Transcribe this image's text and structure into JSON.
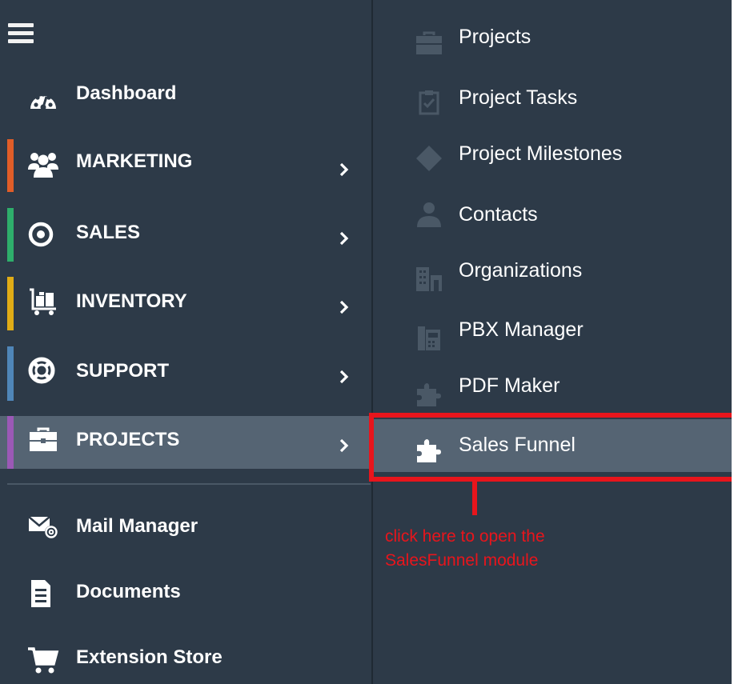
{
  "colors": {
    "sidebar_bg": "#2d3a48",
    "active_bg": "#556473",
    "highlight": "#e8151c",
    "marketing_accent": "#e05d28",
    "sales_accent": "#2eae6b",
    "inventory_accent": "#e0ac16",
    "support_accent": "#4f86b8",
    "projects_accent": "#9b59b6"
  },
  "sidebar": {
    "menu_icon": "hamburger-icon",
    "items": [
      {
        "label": "Dashboard",
        "icon": "dashboard-gauge-icon"
      },
      {
        "label": "MARKETING",
        "icon": "users-group-icon",
        "has_submenu": true
      },
      {
        "label": "SALES",
        "icon": "target-icon",
        "has_submenu": true
      },
      {
        "label": "INVENTORY",
        "icon": "inventory-cart-icon",
        "has_submenu": true
      },
      {
        "label": "SUPPORT",
        "icon": "lifebuoy-icon",
        "has_submenu": true
      },
      {
        "label": "PROJECTS",
        "icon": "briefcase-icon",
        "has_submenu": true,
        "active": true
      }
    ],
    "footer_items": [
      {
        "label": "Mail Manager",
        "icon": "mail-at-icon"
      },
      {
        "label": "Documents",
        "icon": "document-icon"
      },
      {
        "label": "Extension Store",
        "icon": "shopping-cart-icon"
      }
    ]
  },
  "submenu": {
    "items": [
      {
        "label": "Projects",
        "icon": "briefcase-icon"
      },
      {
        "label": "Project Tasks",
        "icon": "clipboard-check-icon"
      },
      {
        "label": "Project Milestones",
        "icon": "diamond-icon"
      },
      {
        "label": "Contacts",
        "icon": "person-icon"
      },
      {
        "label": "Organizations",
        "icon": "building-icon"
      },
      {
        "label": "PBX Manager",
        "icon": "phone-exchange-icon"
      },
      {
        "label": "PDF Maker",
        "icon": "puzzle-icon"
      },
      {
        "label": "Sales Funnel",
        "icon": "puzzle-icon",
        "active": true
      }
    ]
  },
  "annotation": {
    "line1": "click here to open the",
    "line2": "SalesFunnel module"
  }
}
